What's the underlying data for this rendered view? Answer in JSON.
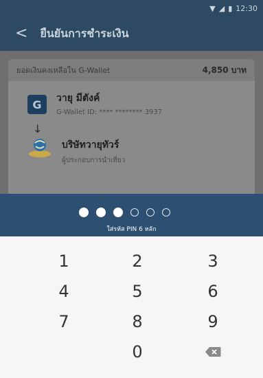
{
  "status_bar": {
    "time": "12:30",
    "wifi_icon": "▼",
    "signal_icon": "◢",
    "battery_icon": "▮"
  },
  "app_bar": {
    "back_icon": "<",
    "title": "ยืนยันการชำระเงิน"
  },
  "balance": {
    "label": "ยอดเงินคงเหลือใน G-Wallet",
    "amount": "4,850 บาท"
  },
  "payer": {
    "logo": "G",
    "name": "วายุ มีตังค์",
    "wallet_id": "G-Wallet ID: **** ******** 3937"
  },
  "arrow": "↓",
  "merchant": {
    "name": "บริษัทวายุทัวร์",
    "type": "ผู้ประกอบการนำเที่ยว"
  },
  "pin": {
    "total_digits": 6,
    "entered_digits": 3,
    "instruction": "ใส่รหัส PIN 6 หลัก"
  },
  "keypad": {
    "keys": [
      "1",
      "2",
      "3",
      "4",
      "5",
      "6",
      "7",
      "8",
      "9",
      "0"
    ],
    "backspace_icon": "backspace-icon"
  },
  "colors": {
    "appbar": "#2e4a63",
    "pin_panel": "#2c4f72",
    "keypad_bg": "#f6f6f6",
    "overlay_gray": "#8a8a8a"
  }
}
